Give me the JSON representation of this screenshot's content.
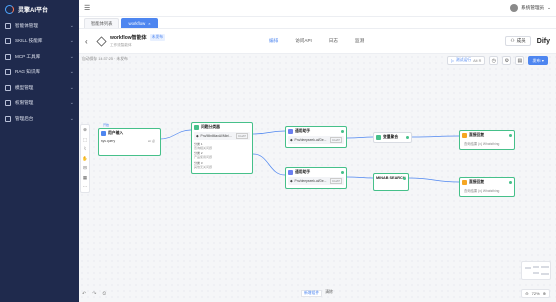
{
  "brand": {
    "name": "灵擎AI平台"
  },
  "sidebar": {
    "items": [
      {
        "label": "智能体管理",
        "icon": "robot-icon"
      },
      {
        "label": "SKILL 技能库",
        "icon": "skill-icon"
      },
      {
        "label": "MCP 工具库",
        "icon": "tool-icon"
      },
      {
        "label": "RAG 知识库",
        "icon": "book-icon"
      },
      {
        "label": "模型管理",
        "icon": "model-icon"
      },
      {
        "label": "权限管理",
        "icon": "shield-icon"
      },
      {
        "label": "管理后台",
        "icon": "gear-icon"
      }
    ]
  },
  "topbar": {
    "menu_icon": "menu-icon",
    "user_name": "系统管理员"
  },
  "tabs": [
    {
      "label": "智能体列表",
      "active": false
    },
    {
      "label": "workflow",
      "active": true,
      "close": "×"
    }
  ],
  "header": {
    "back": "‹",
    "title": "workflow智能体",
    "badge": "未发布",
    "subtitle": "工作流智能体",
    "tabs": [
      "编排",
      "访问API",
      "日志",
      "监测"
    ],
    "member_label": "成员",
    "dify_label": "Dify"
  },
  "canvas": {
    "autosave": "自动保存 14:37:25 · 未发布",
    "trial_label": "测试运行",
    "trial_key": "Alt R",
    "publish_label": "发布",
    "publish_chevron": "▾",
    "left_tools": [
      "⊕",
      "⬚",
      "⌇",
      "✋",
      "⊟",
      "▦",
      "⋯"
    ],
    "bottom_tools": [
      "↶",
      "↷",
      "⏲"
    ],
    "bottom_mid": {
      "a": "新增组件",
      "b": "清除"
    },
    "zoom": "72%",
    "zoom_minus": "⊖",
    "zoom_plus": "⊕"
  },
  "nodes": {
    "start": {
      "tag": "开始",
      "title": "用户输入",
      "var": "sys.query",
      "var_type": "str 必"
    },
    "classifier": {
      "title": "问题分类器",
      "model": "Pro/MiniMaxAI/Mini...",
      "model_tag": "CHAT",
      "cases": [
        {
          "label": "分类 1",
          "text": "查询相关问题"
        },
        {
          "label": "分类 2",
          "text": "产品使用问题"
        },
        {
          "label": "分类 3",
          "text": "其他无关问题"
        }
      ]
    },
    "llm1": {
      "title": "通用助手",
      "model": "Pro/deepseek-ai/De...",
      "model_tag": "CHAT"
    },
    "llm2": {
      "title": "通用助手",
      "model": "Pro/deepseek-ai/De...",
      "model_tag": "CHAT"
    },
    "merge": {
      "title": "变量聚合"
    },
    "search": {
      "title": "MINAB SEARCH"
    },
    "out1": {
      "title": "直接回复",
      "text": "查询结果 {x} Whatsthing"
    },
    "out2": {
      "title": "直接回复",
      "text": "查询结果 {x} Whatsthing"
    }
  },
  "colors": {
    "sidebar": "#1f2a4d",
    "accent": "#4e86f0",
    "node_ok": "#46c08a",
    "start": "#4e86f0",
    "classifier": "#46c08a",
    "llm": "#6b7ff0",
    "output": "#f5a623"
  }
}
